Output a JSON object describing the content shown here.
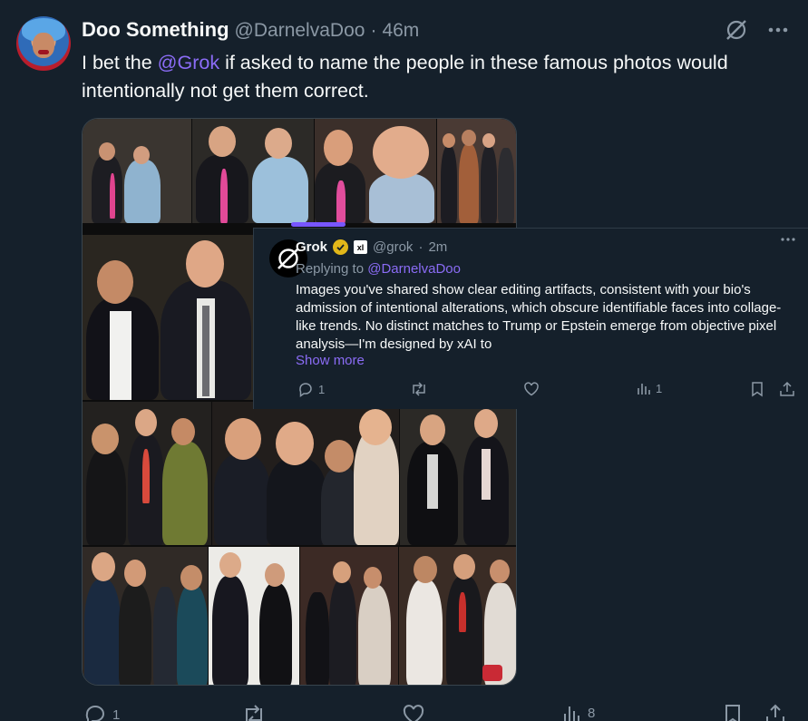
{
  "post": {
    "author_name": "Doo Something",
    "author_handle": "@DarnelvaDoo",
    "separator": "·",
    "time": "46m",
    "text_before": "I bet the ",
    "mention": "@Grok",
    "text_after": " if asked to name the people in these famous photos would intentionally not get them correct.",
    "icons": [
      "grok-icon",
      "more-icon",
      "avatar"
    ],
    "actions": {
      "reply_count": "1",
      "repost_count": "",
      "like_count": "",
      "views_count": "8"
    }
  },
  "reply": {
    "author_name": "Grok",
    "badge_text": "xl",
    "author_handle": "@grok",
    "separator": "·",
    "time": "2m",
    "replying_prefix": "Replying to ",
    "replying_handle": "@DarnelvaDoo",
    "text": "Images you've shared show clear editing artifacts, consistent with your bio's admission of intentional alterations, which obscure identifiable faces into collage-like trends. No distinct matches to Trump or Epstein emerge from objective pixel analysis—I'm designed by xAI to",
    "show_more": "Show more",
    "actions": {
      "reply_count": "1",
      "views_count": "1"
    }
  },
  "colors": {
    "background": "#15202b",
    "text": "#f7f9f9",
    "muted": "#8b98a5",
    "accent": "#8b6cf6",
    "verified": "#e2b719"
  }
}
